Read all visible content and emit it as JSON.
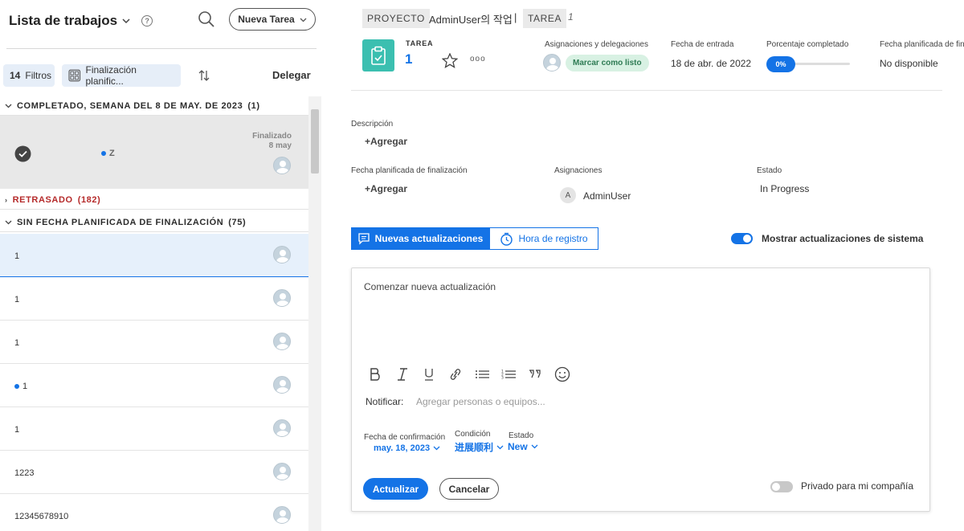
{
  "worklist": {
    "title": "Lista de trabajos",
    "help": "?",
    "new_task_label": "Nueva Tarea",
    "filters_count": "14",
    "filters_label": "Filtros",
    "sort_label": "Finalización planific...",
    "delegate_label": "Delegar"
  },
  "groups": {
    "completed": {
      "label": "COMPLETADO, SEMANA DEL 8 DE MAY. DE 2023",
      "count": "(1)"
    },
    "late": {
      "label": "RETRASADO",
      "count": "(182)"
    },
    "no_date": {
      "label": "SIN FECHA PLANIFICADA DE FINALIZACIÓN",
      "count": "(75)"
    }
  },
  "completed_item": {
    "name": "Z",
    "status": "Finalizado",
    "date": "8 may"
  },
  "rows": [
    {
      "name": "1",
      "dot": false,
      "selected": true
    },
    {
      "name": "1",
      "dot": false,
      "selected": false
    },
    {
      "name": "1",
      "dot": false,
      "selected": false
    },
    {
      "name": "1",
      "dot": true,
      "selected": false
    },
    {
      "name": "1",
      "dot": false,
      "selected": false
    },
    {
      "name": "1223",
      "dot": false,
      "selected": false
    },
    {
      "name": "12345678910",
      "dot": false,
      "selected": false
    }
  ],
  "breadcrumb": {
    "project_tag": "PROYECTO",
    "project_name": "AdminUser의 작업",
    "separator": "|",
    "task_tag": "TAREA",
    "task_name": "1"
  },
  "task": {
    "type_label": "TAREA",
    "number": "1",
    "more": "ooo"
  },
  "header_fields": {
    "assignments_label": "Asignaciones y delegaciones",
    "mark_done": "Marcar como listo",
    "entry_date_label": "Fecha de entrada",
    "entry_date": "18 de abr. de 2022",
    "percent_label": "Porcentaje completado",
    "percent_value": "0%",
    "planned_label": "Fecha planificada de fin",
    "planned_value": "No disponible"
  },
  "percent_complete": 0,
  "details": {
    "description_label": "Descripción",
    "description_add": "+Agregar",
    "planned_completion_label": "Fecha planificada de finalización",
    "planned_completion_add": "+Agregar",
    "assignments_label": "Asignaciones",
    "assignee_initial": "A",
    "assignee": "AdminUser",
    "status_label": "Estado",
    "status": "In Progress"
  },
  "tabs": {
    "new_updates": "Nuevas actualizaciones",
    "time_log": "Hora de registro"
  },
  "system_updates": {
    "label": "Mostrar actualizaciones de sistema",
    "on": true
  },
  "editor": {
    "placeholder": "Comenzar nueva actualización",
    "notify_label": "Notificar:",
    "notify_placeholder": "Agregar personas o equipos...",
    "commit_date_label": "Fecha de confirmación",
    "commit_date": "may. 18, 2023",
    "condition_label": "Condición",
    "condition": "进展顺利",
    "status_label": "Estado",
    "status": "New",
    "update_button": "Actualizar",
    "cancel_button": "Cancelar",
    "private_label": "Privado para mi compañía"
  },
  "colors": {
    "accent": "#1473e6",
    "task_icon": "#3bbfb0",
    "late": "#b52a2a",
    "done_chip_bg": "#d8f1e3"
  }
}
